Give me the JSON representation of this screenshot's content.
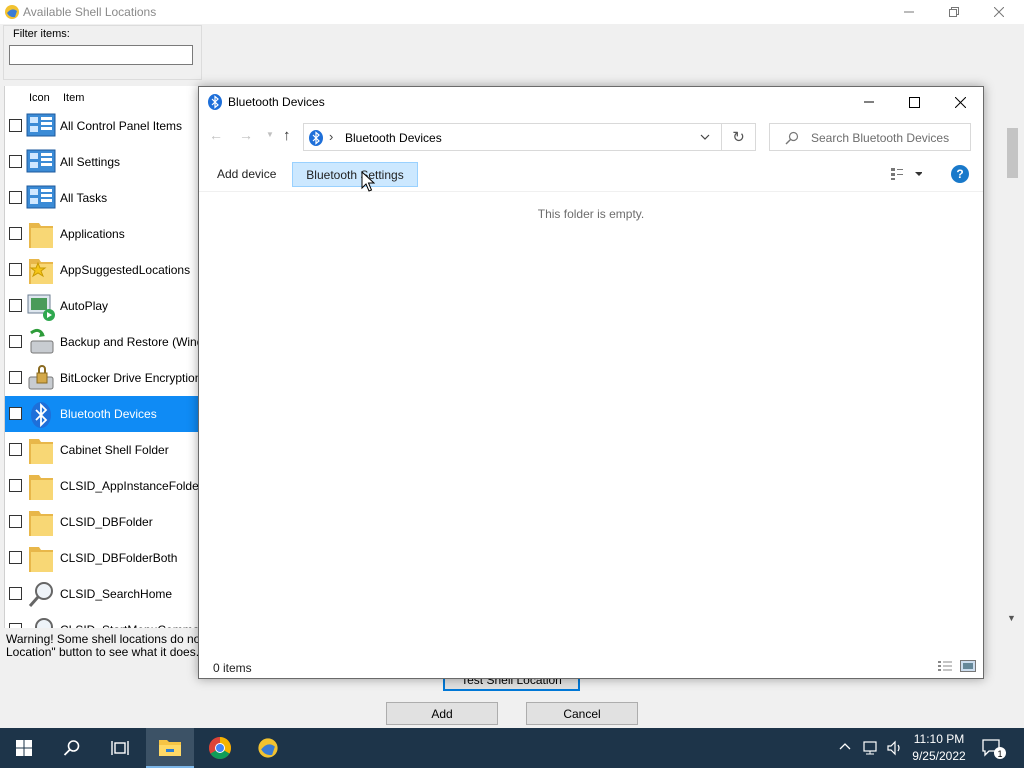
{
  "bg_dialog": {
    "title": "Available Shell Locations",
    "filter_label": "Filter items:",
    "filter_value": "",
    "list_header": {
      "icon": "Icon",
      "item": "Item"
    },
    "items": [
      {
        "label": "All Control Panel Items",
        "icon": "control-panel-icon",
        "checked": false
      },
      {
        "label": "All Settings",
        "icon": "control-panel-icon",
        "checked": false
      },
      {
        "label": "All Tasks",
        "icon": "control-panel-icon",
        "checked": false
      },
      {
        "label": "Applications",
        "icon": "folder-icon",
        "checked": false
      },
      {
        "label": "AppSuggestedLocations",
        "icon": "star-folder-icon",
        "checked": false
      },
      {
        "label": "AutoPlay",
        "icon": "autoplay-icon",
        "checked": false
      },
      {
        "label": "Backup and Restore (Windov",
        "icon": "backup-icon",
        "checked": false
      },
      {
        "label": "BitLocker Drive Encryption",
        "icon": "bitlocker-icon",
        "checked": false
      },
      {
        "label": "Bluetooth Devices",
        "icon": "bluetooth-icon",
        "checked": false,
        "selected": true
      },
      {
        "label": "Cabinet Shell Folder",
        "icon": "folder-icon",
        "checked": false
      },
      {
        "label": "CLSID_AppInstanceFolder",
        "icon": "folder-icon",
        "checked": false
      },
      {
        "label": "CLSID_DBFolder",
        "icon": "folder-icon",
        "checked": false
      },
      {
        "label": "CLSID_DBFolderBoth",
        "icon": "folder-icon",
        "checked": false
      },
      {
        "label": "CLSID_SearchHome",
        "icon": "search-icon",
        "checked": false
      },
      {
        "label": "CLSID_StartMenuCommandi",
        "icon": "search-icon",
        "checked": false
      }
    ],
    "warning_line1": "Warning! Some shell locations do not wo",
    "warning_line2": "Location\" button to see what it does.",
    "test_button": "Test Shell Location",
    "add_button": "Add",
    "cancel_button": "Cancel"
  },
  "explorer": {
    "title": "Bluetooth Devices",
    "address": "Bluetooth Devices",
    "address_separator": "›",
    "search_placeholder": "Search Bluetooth Devices",
    "commands": {
      "add_device": "Add device",
      "bluetooth_settings": "Bluetooth Settings"
    },
    "help_label": "?",
    "empty_message": "This folder is empty.",
    "status_count": "0 items"
  },
  "taskbar": {
    "time": "11:10 PM",
    "date": "9/25/2022",
    "notification_count": "1"
  },
  "colors": {
    "selection": "#0f8bf5",
    "taskbar": "#1d3449",
    "accent": "#0078d7",
    "command_hover": "#cce8ff"
  }
}
